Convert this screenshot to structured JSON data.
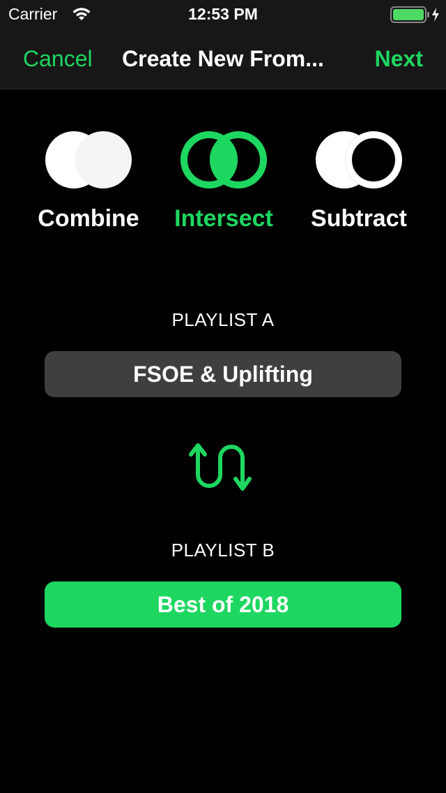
{
  "status_bar": {
    "carrier": "Carrier",
    "time": "12:53 PM",
    "battery_color": "#4cd964"
  },
  "nav": {
    "cancel_label": "Cancel",
    "title": "Create New From...",
    "next_label": "Next"
  },
  "operations": {
    "selected": "Intersect",
    "accent_color": "#1ed760",
    "combine_label": "Combine",
    "intersect_label": "Intersect",
    "subtract_label": "Subtract"
  },
  "playlist_a": {
    "section_label": "PLAYLIST A",
    "name": "FSOE & Uplifting"
  },
  "playlist_b": {
    "section_label": "PLAYLIST B",
    "name": "Best of 2018"
  },
  "icons": {
    "swap": "swap-arrows-icon"
  }
}
